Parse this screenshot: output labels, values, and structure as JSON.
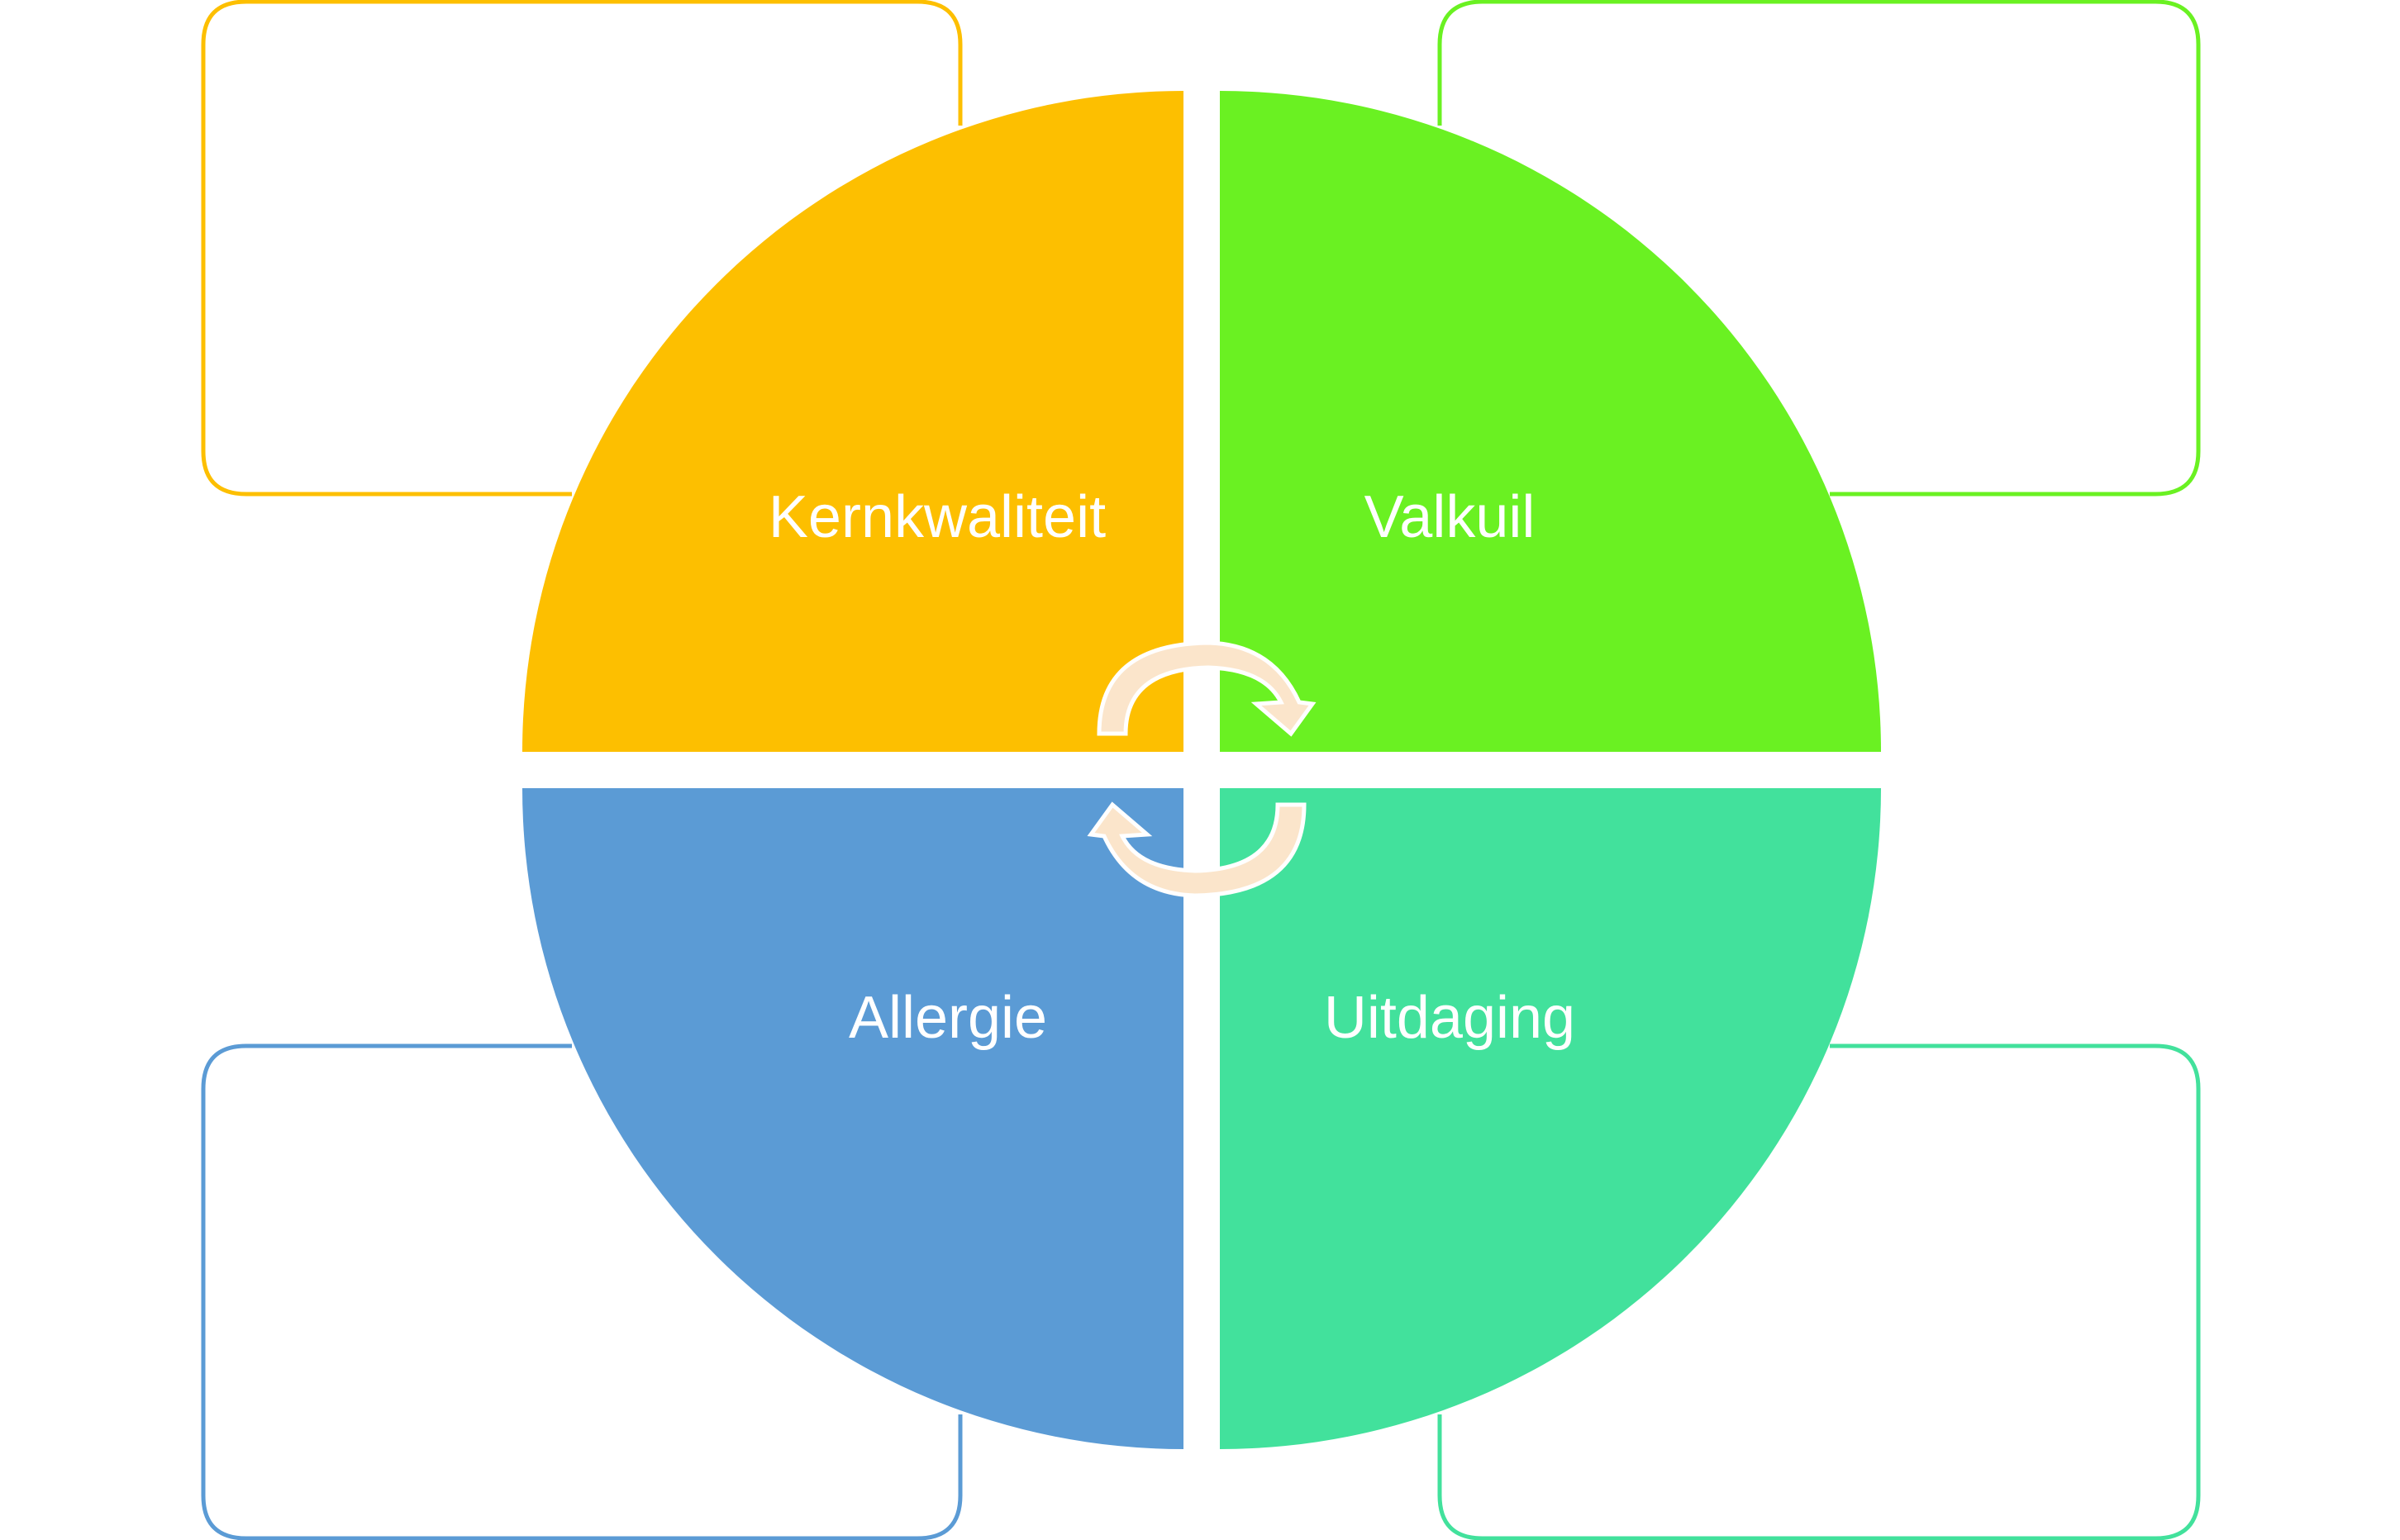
{
  "diagram": {
    "quadrants": [
      {
        "id": "kernkwaliteit",
        "label": "Kernkwaliteit",
        "color": "#FDBF00"
      },
      {
        "id": "valkuil",
        "label": "Valkuil",
        "color": "#6AF122"
      },
      {
        "id": "allergie",
        "label": "Allergie",
        "color": "#5B9BD5"
      },
      {
        "id": "uitdaging",
        "label": "Uitdaging",
        "color": "#42E19C"
      }
    ],
    "arrow_color": "#FBE5CB",
    "background": "#FFFFFF"
  }
}
